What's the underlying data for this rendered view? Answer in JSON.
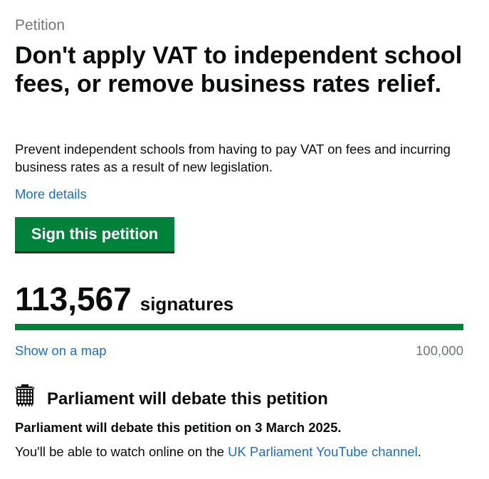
{
  "petition": {
    "caption": "Petition",
    "title": "Don't apply VAT to independent school fees, or remove business rates relief.",
    "summary": "Prevent independent schools from having to pay VAT on fees and incurring business rates as a result of new legislation.",
    "more_details_label": "More details",
    "sign_button_label": "Sign this petition"
  },
  "signatures": {
    "count": "113,567",
    "label": "signatures",
    "threshold": "100,000",
    "progress_fraction": 1.0,
    "show_map_label": "Show on a map",
    "progress_color": "#00823b"
  },
  "debate": {
    "icon": "portcullis-icon",
    "heading": "Parliament will debate this petition",
    "date_text": "Parliament will debate this petition on 3 March 2025.",
    "watch_prefix": "You'll be able to watch online on the ",
    "watch_link_label": "UK Parliament YouTube channel",
    "watch_suffix": "."
  },
  "colors": {
    "link": "#1d70b8",
    "button": "#00823b",
    "caption": "#6f777b"
  }
}
